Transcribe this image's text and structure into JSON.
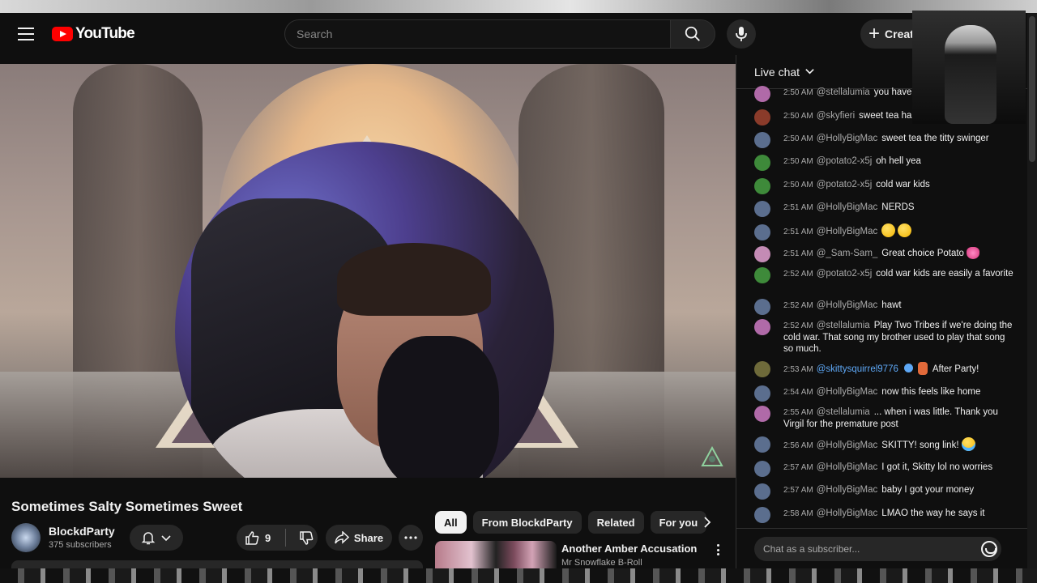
{
  "header": {
    "logo_text": "YouTube",
    "search_placeholder": "Search",
    "create_label": "Creat"
  },
  "video": {
    "title": "Sometimes Salty Sometimes Sweet",
    "channel": "BlockdParty",
    "subscribers": "375 subscribers",
    "likes": "9",
    "share_label": "Share"
  },
  "chips": [
    "All",
    "From BlockdParty",
    "Related",
    "For you"
  ],
  "recommendation": {
    "title": "Another Amber Accusation",
    "channel": "Mr Snowflake B-Roll"
  },
  "chat": {
    "header": "Live chat",
    "input_placeholder": "Chat as a subscriber...",
    "messages": [
      {
        "time": "2:50 AM",
        "author": "@stellalumia",
        "text": "you have"
      },
      {
        "time": "2:50 AM",
        "author": "@skyfieri",
        "text": "sweet tea ha"
      },
      {
        "time": "2:50 AM",
        "author": "@HollyBigMac",
        "text": "sweet tea the titty swinger"
      },
      {
        "time": "2:50 AM",
        "author": "@potato2-x5j",
        "text": "oh hell yea"
      },
      {
        "time": "2:50 AM",
        "author": "@potato2-x5j",
        "text": "cold war kids"
      },
      {
        "time": "2:51 AM",
        "author": "@HollyBigMac",
        "text": "NERDS"
      },
      {
        "time": "2:51 AM",
        "author": "@HollyBigMac",
        "text": ""
      },
      {
        "time": "2:51 AM",
        "author": "@_Sam-Sam_",
        "text": "Great choice Potato"
      },
      {
        "time": "2:52 AM",
        "author": "@potato2-x5j",
        "text": "cold war kids are easily a favorite"
      },
      {
        "time": "2:52 AM",
        "author": "@HollyBigMac",
        "text": "hawt"
      },
      {
        "time": "2:52 AM",
        "author": "@stellalumia",
        "text": "Play Two Tribes if we're doing the cold war. That song my brother used to play that song so much."
      },
      {
        "time": "2:53 AM",
        "author": "@skittysquirrel9776",
        "text": "After Party!"
      },
      {
        "time": "2:54 AM",
        "author": "@HollyBigMac",
        "text": "now this feels like home"
      },
      {
        "time": "2:55 AM",
        "author": "@stellalumia",
        "text": "... when i was little. Thank you Virgil for the premature post"
      },
      {
        "time": "2:56 AM",
        "author": "@HollyBigMac",
        "text": "SKITTY! song link!"
      },
      {
        "time": "2:57 AM",
        "author": "@HollyBigMac",
        "text": "I got it, Skitty lol no worries"
      },
      {
        "time": "2:57 AM",
        "author": "@HollyBigMac",
        "text": "baby I got your money"
      },
      {
        "time": "2:58 AM",
        "author": "@HollyBigMac",
        "text": "LMAO the way he says it"
      }
    ]
  },
  "colors": {
    "accent_red": "#ff0000",
    "chat_link_blue": "#5ea8f6",
    "background": "#0f0f0f"
  }
}
